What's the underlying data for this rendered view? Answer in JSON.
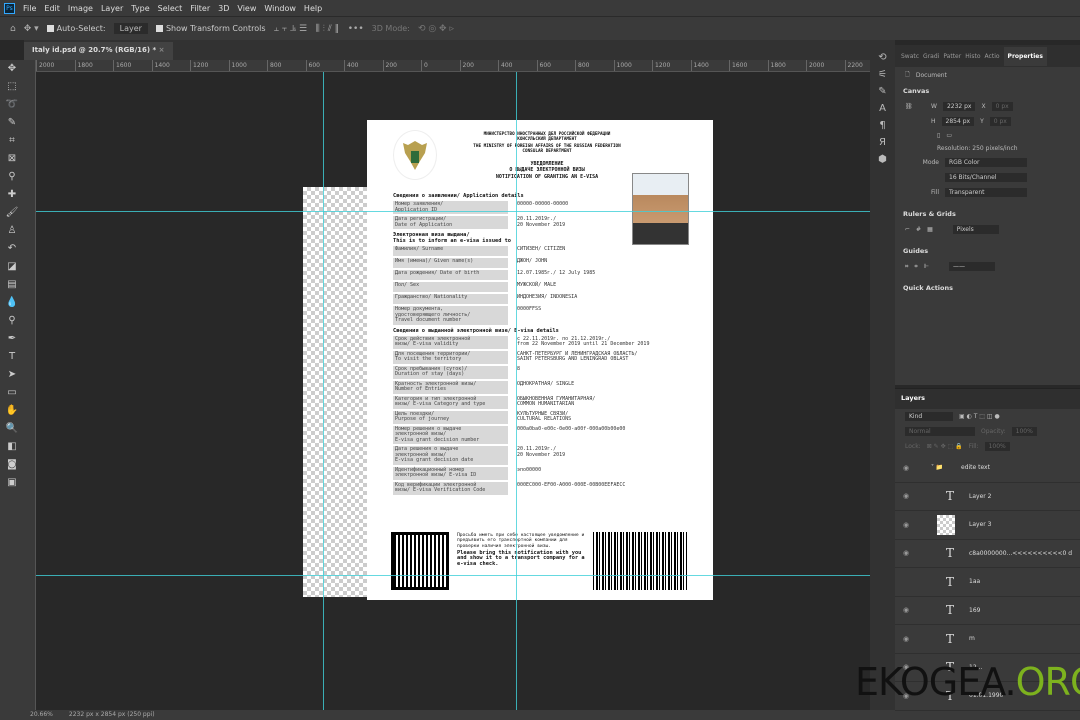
{
  "menu": {
    "items": [
      "File",
      "Edit",
      "Image",
      "Layer",
      "Type",
      "Select",
      "Filter",
      "3D",
      "View",
      "Window",
      "Help"
    ]
  },
  "options": {
    "auto_select": "Auto-Select:",
    "auto_select_value": "Layer",
    "show_transform": "Show Transform Controls",
    "mode_3d": "3D Mode:"
  },
  "tab": {
    "title": "Italy id.psd @ 20.7% (RGB/16) *",
    "close": "×"
  },
  "ruler": [
    "2000",
    "1800",
    "1600",
    "1400",
    "1200",
    "1000",
    "800",
    "600",
    "400",
    "200",
    "0",
    "200",
    "400",
    "600",
    "800",
    "1000",
    "1200",
    "1400",
    "1600",
    "1800",
    "2000",
    "2200"
  ],
  "document": {
    "header_ru": "МИНИСТЕРСТВО ИНОСТРАННЫХ ДЕЛ РОССИЙСКОЙ ФЕДЕРАЦИИ\nКОНСУЛЬСКИЙ ДЕПАРТАМЕНТ",
    "header_en": "THE MINISTRY OF FOREIGN AFFAIRS OF THE RUSSIAN FEDERATION\nCONSULAR DEPARTMENT",
    "title_ru": "УВЕДОМЛЕНИЕ\nО ВЫДАЧЕ ЭЛЕКТРОННОЙ ВИЗЫ",
    "title_en": "NOTIFICATION OF GRANTING AN E-VISA",
    "sec1": "Сведения о заявлении/ Application details",
    "app": [
      [
        "Номер заявления/\nApplication ID",
        "00000-00000-00000"
      ],
      [
        "Дата регистрации/\nDate of Application",
        "20.11.2019г./\n20 November 2019"
      ]
    ],
    "sec2": "Электронная виза выдана/\nThis is to inform an e-visa issued to",
    "person": [
      [
        "Фамилия/ Surname",
        "СИТИЗЕН/ CITIZEN"
      ],
      [
        "Имя (имена)/ Given name(s)",
        "ДЖОН/ JOHN"
      ],
      [
        "Дата рождения/ Date of birth",
        "12.07.1985г./ 12 July 1985"
      ],
      [
        "Пол/ Sex",
        "МУЖСКОЙ/ MALE"
      ],
      [
        "Гражданство/ Nationality",
        "ИНДОНЕЗИЯ/ INDONESIA"
      ],
      [
        "Номер документа,\nудостоверяющего личность/\nTravel document number",
        "0000FFSS"
      ]
    ],
    "sec3": "Сведения о выданной электронной визе/ E-visa details",
    "visa": [
      [
        "Срок действия электронной\nвизы/ E-visa validity",
        "с 22.11.2019г. по 21.12.2019г./\nfrom 22 November 2019 until 21 December 2019"
      ],
      [
        "Для посещения территории/\nTo visit the territory",
        "САНКТ-ПЕТЕРБУРГ И ЛЕНИНГРАДСКАЯ ОБЛАСТЬ/\nSAINT PETERSBURG AND LENINGRAD OBLAST"
      ],
      [
        "Срок пребывания (суток)/\nDuration of stay (days)",
        "8"
      ],
      [
        "Кратность электронной визы/\nNumber of Entries",
        "ОДНОКРАТНАЯ/ SINGLE"
      ],
      [
        "Категория и тип электронной\nвизы/ E-visa Category and type",
        "ОБЫКНОВЕННАЯ ГУМАНИТАРНАЯ/\nCOMMON HUMANITARIAN"
      ],
      [
        "Цель поездки/\nPurpose of journey",
        "КУЛЬТУРНЫЕ СВЯЗИ/\nCULTURAL RELATIONS"
      ],
      [
        "Номер решения о выдаче\nэлектронной визы/\nE-visa grant decision number",
        "000a0ba0-e00c-0e00-a00f-000a00b00e00"
      ],
      [
        "Дата решения о выдаче\nэлектронной визы/\nE-visa grant decision date",
        "20.11.2019г./\n20 November 2019"
      ],
      [
        "Идентификационный номер\nэлектронной визы/ E-visa ID",
        "эпо00000"
      ],
      [
        "Код верификации электронной\nвизы/ E-visa Verification Code",
        "000EC000-EF00-A000-000E-00B00EEFAECC"
      ]
    ],
    "note_ru": "Просьба иметь при себе настоящее уведомление и предъявить его транспортной компании для проверки наличия электронной визы.",
    "note_en": "Please bring this notification with you and show it to a transport company for a e-visa check."
  },
  "props": {
    "tabs": [
      "Swatc",
      "Gradi",
      "Patter",
      "Histo",
      "Actio",
      "Properties"
    ],
    "doc": "Document",
    "canvas": "Canvas",
    "w_label": "W",
    "w": "2232 px",
    "h_label": "H",
    "h": "2854 px",
    "x_label": "X",
    "y_label": "Y",
    "x_ph": "0 px",
    "y_ph": "0 px",
    "resolution": "Resolution: 250 pixels/inch",
    "mode_label": "Mode",
    "mode": "RGB Color",
    "depth": "16 Bits/Channel",
    "fill_label": "Fill",
    "fill": "Transparent",
    "rulers": "Rulers & Grids",
    "units": "Pixels",
    "guides": "Guides",
    "quick": "Quick Actions"
  },
  "layers": {
    "title": "Layers",
    "kind": "Kind",
    "blend": "Normal",
    "opacity_label": "Opacity:",
    "opacity": "100%",
    "lock_label": "Lock:",
    "fill_label": "Fill:",
    "fill": "100%",
    "items": [
      {
        "name": "edite text",
        "type": "group"
      },
      {
        "name": "Layer 2",
        "type": "text"
      },
      {
        "name": "Layer 3",
        "type": "image"
      },
      {
        "name": "c8a0000000...<<<<<<<<<<0 d",
        "type": "text"
      },
      {
        "name": "1aa",
        "type": "text"
      },
      {
        "name": "169",
        "type": "text"
      },
      {
        "name": "m",
        "type": "text"
      },
      {
        "name": "12...",
        "type": "text"
      },
      {
        "name": "01.01.1990",
        "type": "text"
      }
    ]
  },
  "status": {
    "zoom": "20.66%",
    "info": "2232 px x 2854 px (250 ppi)"
  },
  "watermark": {
    "a": "EKOGEA.",
    "b": "ORG"
  }
}
